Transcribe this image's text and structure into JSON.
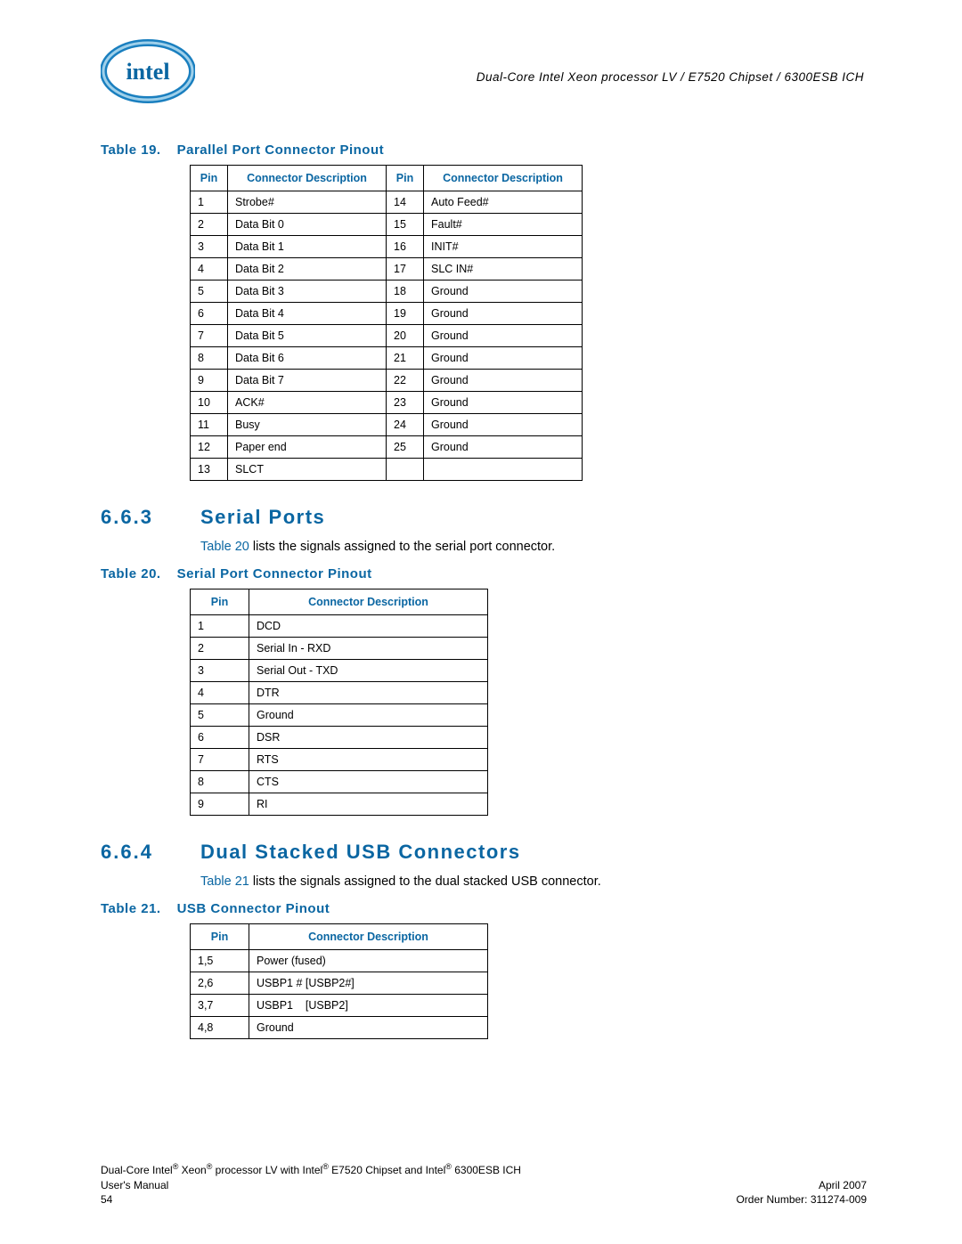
{
  "header": {
    "running_title": "Dual-Core Intel Xeon processor LV / E7520 Chipset / 6300ESB ICH"
  },
  "table19": {
    "caption_prefix": "Table 19.",
    "caption_title": "Parallel Port Connector Pinout",
    "col_pin": "Pin",
    "col_desc": "Connector Description",
    "rows": [
      {
        "p1": "1",
        "d1": "Strobe#",
        "p2": "14",
        "d2": "Auto Feed#"
      },
      {
        "p1": "2",
        "d1": "Data Bit 0",
        "p2": "15",
        "d2": "Fault#"
      },
      {
        "p1": "3",
        "d1": "Data Bit 1",
        "p2": "16",
        "d2": "INIT#"
      },
      {
        "p1": "4",
        "d1": "Data Bit 2",
        "p2": "17",
        "d2": "SLC IN#"
      },
      {
        "p1": "5",
        "d1": "Data Bit 3",
        "p2": "18",
        "d2": "Ground"
      },
      {
        "p1": "6",
        "d1": "Data Bit 4",
        "p2": "19",
        "d2": "Ground"
      },
      {
        "p1": "7",
        "d1": "Data Bit 5",
        "p2": "20",
        "d2": "Ground"
      },
      {
        "p1": "8",
        "d1": "Data Bit 6",
        "p2": "21",
        "d2": "Ground"
      },
      {
        "p1": "9",
        "d1": "Data Bit 7",
        "p2": "22",
        "d2": "Ground"
      },
      {
        "p1": "10",
        "d1": "ACK#",
        "p2": "23",
        "d2": "Ground"
      },
      {
        "p1": "11",
        "d1": "Busy",
        "p2": "24",
        "d2": "Ground"
      },
      {
        "p1": "12",
        "d1": "Paper end",
        "p2": "25",
        "d2": "Ground"
      },
      {
        "p1": "13",
        "d1": "SLCT",
        "p2": "",
        "d2": ""
      }
    ]
  },
  "section663": {
    "num": "6.6.3",
    "title": "Serial Ports",
    "body_ref": "Table 20",
    "body_rest": " lists the signals assigned to the serial port connector."
  },
  "table20": {
    "caption_prefix": "Table 20.",
    "caption_title": "Serial Port Connector Pinout",
    "col_pin": "Pin",
    "col_desc": "Connector Description",
    "rows": [
      {
        "p": "1",
        "d": "DCD"
      },
      {
        "p": "2",
        "d": "Serial In - RXD"
      },
      {
        "p": "3",
        "d": "Serial Out - TXD"
      },
      {
        "p": "4",
        "d": "DTR"
      },
      {
        "p": "5",
        "d": "Ground"
      },
      {
        "p": "6",
        "d": "DSR"
      },
      {
        "p": "7",
        "d": "RTS"
      },
      {
        "p": "8",
        "d": "CTS"
      },
      {
        "p": "9",
        "d": "RI"
      }
    ]
  },
  "section664": {
    "num": "6.6.4",
    "title": "Dual Stacked USB Connectors",
    "body_ref": "Table 21",
    "body_rest": " lists the signals assigned to the dual stacked USB connector."
  },
  "table21": {
    "caption_prefix": "Table 21.",
    "caption_title": "USB Connector Pinout",
    "col_pin": "Pin",
    "col_desc": "Connector Description",
    "rows": [
      {
        "p": "1,5",
        "d": "Power (fused)"
      },
      {
        "p": "2,6",
        "d": "USBP1 # [USBP2#]"
      },
      {
        "p": "3,7",
        "d": "USBP1    [USBP2]"
      },
      {
        "p": "4,8",
        "d": "Ground"
      }
    ]
  },
  "footer": {
    "line1": "Dual-Core Intel® Xeon® processor LV with Intel® E7520 Chipset and Intel® 6300ESB ICH",
    "line2_left": "User's Manual",
    "line2_right": "April 2007",
    "line3_left": "54",
    "line3_right": "Order Number: 311274-009"
  }
}
